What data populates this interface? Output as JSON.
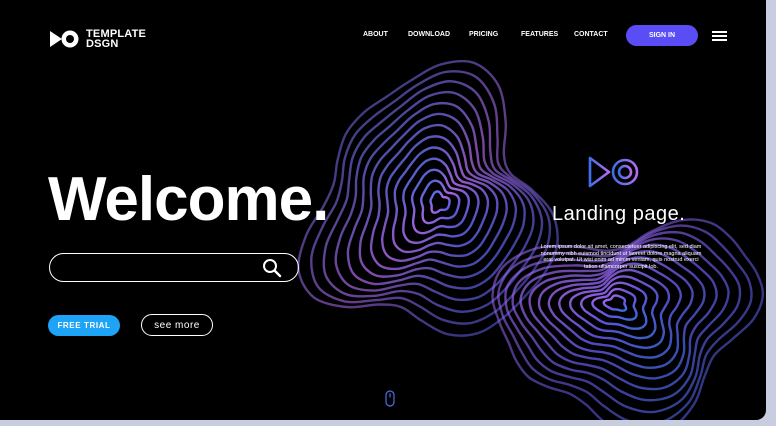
{
  "brand": {
    "line1": "TEMPLATE",
    "line2": "DSGN",
    "logo_icon": "play-circle-logo-icon"
  },
  "nav": {
    "items": [
      {
        "label": "ABOUT"
      },
      {
        "label": "DOWNLOAD"
      },
      {
        "label": "PRICING"
      },
      {
        "label": "FEATURES"
      },
      {
        "label": "CONTACT"
      }
    ],
    "signin_label": "SIGN IN",
    "menu_icon": "hamburger-menu-icon"
  },
  "hero": {
    "headline": "Welcome.",
    "search": {
      "value": "",
      "placeholder": "",
      "icon": "search-icon"
    },
    "primary_button": "FREE TRIAL",
    "secondary_button": "see more"
  },
  "side": {
    "logo_icon": "play-circle-logo-icon",
    "title": "Landing page.",
    "body": "Lorem ipsum dolor sit amet, consectetuer adipiscing elit, sed diam nonummy nibh euismod tincidunt ut laoreet dolore magna aliquam erat volutpat. Ut wisi enim ad minim veniam, quis nostrud exerci tation ullamcorper suscipit lob."
  },
  "scroll_icon": "mouse-scroll-icon",
  "colors": {
    "background": "#000000",
    "accent_signin": "#5a4df5",
    "accent_trial": "#1ea4f6",
    "topo_blue": "#3f6fe8",
    "topo_purple": "#b46cf0"
  }
}
